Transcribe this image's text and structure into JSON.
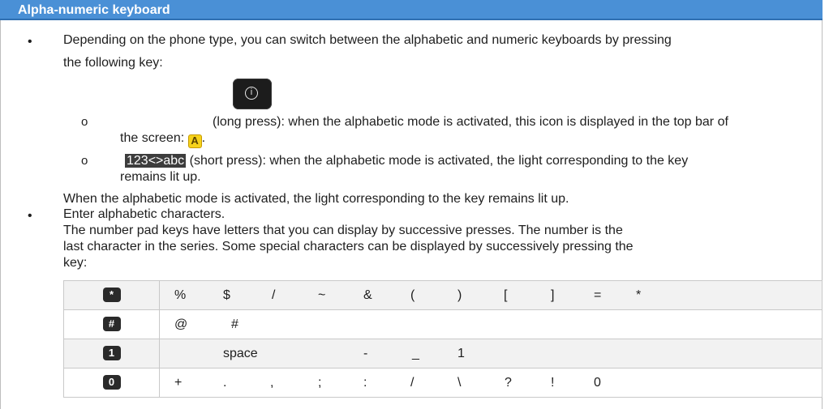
{
  "header": {
    "title": "Alpha-numeric keyboard"
  },
  "bullet1": {
    "text_line1": "Depending on the phone type, you can switch between the alphabetic and numeric keyboards by pressing",
    "text_line2": "the following key:"
  },
  "key_icon": {
    "icon": "info-key-icon",
    "glyph": "i"
  },
  "sub1": {
    "marker": "o",
    "line1": "(long press): when the alphabetic mode is activated, this icon is displayed in the top bar of",
    "line2": "the screen:",
    "icon_glyph": "A",
    "icon": "alpha-mode-icon",
    "tail": "."
  },
  "sub2": {
    "marker": "o",
    "key_label": "123<>abc",
    "line1": "(short press): when the alphabetic mode is activated, the light corresponding to the key",
    "line2": "remains lit up."
  },
  "note": "When the alphabetic mode is activated, the light corresponding to the key remains lit up.",
  "bullet2": {
    "title": "Enter alphabetic characters.",
    "line1": "The number pad keys have letters that you can display by successive presses. The number is the",
    "line2": "last character in the series. Some special characters can be displayed by successively pressing the",
    "line3": "key:"
  },
  "table": {
    "rows": [
      {
        "key": "*",
        "key_icon": "star-key-icon",
        "chars": [
          "%",
          "$",
          "/",
          "~",
          "&",
          "(",
          ")",
          "[",
          "]",
          "=",
          "*"
        ]
      },
      {
        "key": "#",
        "key_icon": "hash-key-icon",
        "chars": [
          "@",
          "#"
        ]
      },
      {
        "key": "1",
        "key_icon": "one-key-icon",
        "chars": [
          "space",
          "-",
          "_",
          "1"
        ]
      },
      {
        "key": "0",
        "key_icon": "zero-key-icon",
        "chars": [
          "+",
          ".",
          ",",
          ";",
          ":",
          "/",
          "\\",
          "?",
          "!",
          "0"
        ]
      }
    ]
  },
  "colors": {
    "header_bg": "#4a90d6",
    "row_alt": "#f2f2f2",
    "a_icon": "#f6d21b"
  }
}
